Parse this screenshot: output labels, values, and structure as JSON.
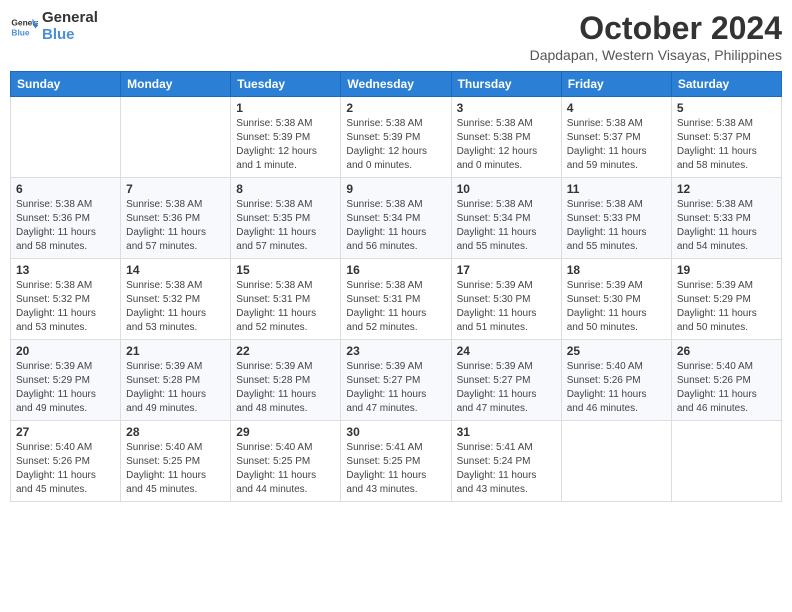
{
  "header": {
    "logo_line1": "General",
    "logo_line2": "Blue",
    "month": "October 2024",
    "location": "Dapdapan, Western Visayas, Philippines"
  },
  "days_of_week": [
    "Sunday",
    "Monday",
    "Tuesday",
    "Wednesday",
    "Thursday",
    "Friday",
    "Saturday"
  ],
  "weeks": [
    [
      {
        "day": "",
        "info": ""
      },
      {
        "day": "",
        "info": ""
      },
      {
        "day": "1",
        "info": "Sunrise: 5:38 AM\nSunset: 5:39 PM\nDaylight: 12 hours\nand 1 minute."
      },
      {
        "day": "2",
        "info": "Sunrise: 5:38 AM\nSunset: 5:39 PM\nDaylight: 12 hours\nand 0 minutes."
      },
      {
        "day": "3",
        "info": "Sunrise: 5:38 AM\nSunset: 5:38 PM\nDaylight: 12 hours\nand 0 minutes."
      },
      {
        "day": "4",
        "info": "Sunrise: 5:38 AM\nSunset: 5:37 PM\nDaylight: 11 hours\nand 59 minutes."
      },
      {
        "day": "5",
        "info": "Sunrise: 5:38 AM\nSunset: 5:37 PM\nDaylight: 11 hours\nand 58 minutes."
      }
    ],
    [
      {
        "day": "6",
        "info": "Sunrise: 5:38 AM\nSunset: 5:36 PM\nDaylight: 11 hours\nand 58 minutes."
      },
      {
        "day": "7",
        "info": "Sunrise: 5:38 AM\nSunset: 5:36 PM\nDaylight: 11 hours\nand 57 minutes."
      },
      {
        "day": "8",
        "info": "Sunrise: 5:38 AM\nSunset: 5:35 PM\nDaylight: 11 hours\nand 57 minutes."
      },
      {
        "day": "9",
        "info": "Sunrise: 5:38 AM\nSunset: 5:34 PM\nDaylight: 11 hours\nand 56 minutes."
      },
      {
        "day": "10",
        "info": "Sunrise: 5:38 AM\nSunset: 5:34 PM\nDaylight: 11 hours\nand 55 minutes."
      },
      {
        "day": "11",
        "info": "Sunrise: 5:38 AM\nSunset: 5:33 PM\nDaylight: 11 hours\nand 55 minutes."
      },
      {
        "day": "12",
        "info": "Sunrise: 5:38 AM\nSunset: 5:33 PM\nDaylight: 11 hours\nand 54 minutes."
      }
    ],
    [
      {
        "day": "13",
        "info": "Sunrise: 5:38 AM\nSunset: 5:32 PM\nDaylight: 11 hours\nand 53 minutes."
      },
      {
        "day": "14",
        "info": "Sunrise: 5:38 AM\nSunset: 5:32 PM\nDaylight: 11 hours\nand 53 minutes."
      },
      {
        "day": "15",
        "info": "Sunrise: 5:38 AM\nSunset: 5:31 PM\nDaylight: 11 hours\nand 52 minutes."
      },
      {
        "day": "16",
        "info": "Sunrise: 5:38 AM\nSunset: 5:31 PM\nDaylight: 11 hours\nand 52 minutes."
      },
      {
        "day": "17",
        "info": "Sunrise: 5:39 AM\nSunset: 5:30 PM\nDaylight: 11 hours\nand 51 minutes."
      },
      {
        "day": "18",
        "info": "Sunrise: 5:39 AM\nSunset: 5:30 PM\nDaylight: 11 hours\nand 50 minutes."
      },
      {
        "day": "19",
        "info": "Sunrise: 5:39 AM\nSunset: 5:29 PM\nDaylight: 11 hours\nand 50 minutes."
      }
    ],
    [
      {
        "day": "20",
        "info": "Sunrise: 5:39 AM\nSunset: 5:29 PM\nDaylight: 11 hours\nand 49 minutes."
      },
      {
        "day": "21",
        "info": "Sunrise: 5:39 AM\nSunset: 5:28 PM\nDaylight: 11 hours\nand 49 minutes."
      },
      {
        "day": "22",
        "info": "Sunrise: 5:39 AM\nSunset: 5:28 PM\nDaylight: 11 hours\nand 48 minutes."
      },
      {
        "day": "23",
        "info": "Sunrise: 5:39 AM\nSunset: 5:27 PM\nDaylight: 11 hours\nand 47 minutes."
      },
      {
        "day": "24",
        "info": "Sunrise: 5:39 AM\nSunset: 5:27 PM\nDaylight: 11 hours\nand 47 minutes."
      },
      {
        "day": "25",
        "info": "Sunrise: 5:40 AM\nSunset: 5:26 PM\nDaylight: 11 hours\nand 46 minutes."
      },
      {
        "day": "26",
        "info": "Sunrise: 5:40 AM\nSunset: 5:26 PM\nDaylight: 11 hours\nand 46 minutes."
      }
    ],
    [
      {
        "day": "27",
        "info": "Sunrise: 5:40 AM\nSunset: 5:26 PM\nDaylight: 11 hours\nand 45 minutes."
      },
      {
        "day": "28",
        "info": "Sunrise: 5:40 AM\nSunset: 5:25 PM\nDaylight: 11 hours\nand 45 minutes."
      },
      {
        "day": "29",
        "info": "Sunrise: 5:40 AM\nSunset: 5:25 PM\nDaylight: 11 hours\nand 44 minutes."
      },
      {
        "day": "30",
        "info": "Sunrise: 5:41 AM\nSunset: 5:25 PM\nDaylight: 11 hours\nand 43 minutes."
      },
      {
        "day": "31",
        "info": "Sunrise: 5:41 AM\nSunset: 5:24 PM\nDaylight: 11 hours\nand 43 minutes."
      },
      {
        "day": "",
        "info": ""
      },
      {
        "day": "",
        "info": ""
      }
    ]
  ]
}
